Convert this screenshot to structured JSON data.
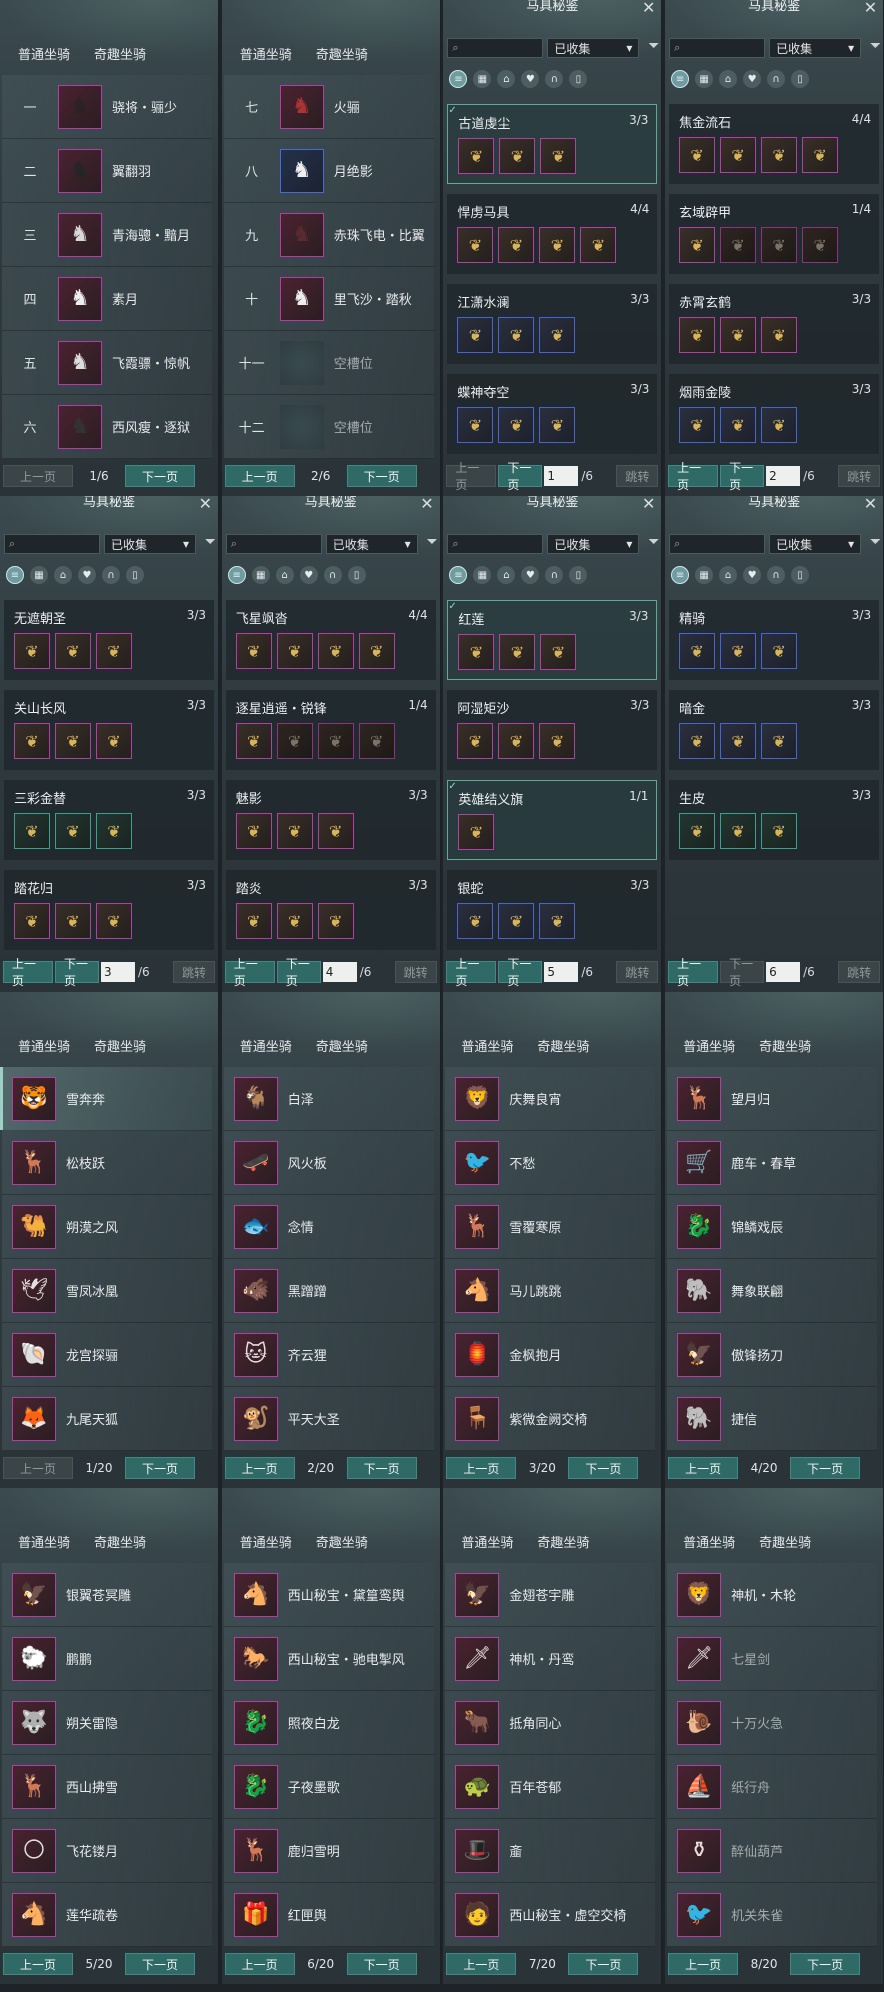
{
  "common": {
    "tab_normal": "普通坐骑",
    "tab_fun": "奇趣坐骑",
    "prev": "上一页",
    "next": "下一页",
    "jump": "跳转",
    "slash": "/",
    "tack_title": "马具秘鉴",
    "filter_value": "已收集"
  },
  "mount_pages": [
    {
      "page": "1/6",
      "prev_off": true,
      "rows": [
        {
          "n": "一",
          "name": "骁将・骊少",
          "c": "#2a2224",
          "g": "♞"
        },
        {
          "n": "二",
          "name": "翼翻羽",
          "c": "#222628",
          "g": "♞"
        },
        {
          "n": "三",
          "name": "青海骢・黯月",
          "c": "#d8d8d8",
          "g": "♞"
        },
        {
          "n": "四",
          "name": "素月",
          "c": "#eee",
          "g": "♞"
        },
        {
          "n": "五",
          "name": "飞霞骠・惊帆",
          "c": "#ddd",
          "g": "♞"
        },
        {
          "n": "六",
          "name": "西风瘦・逐狱",
          "c": "#333",
          "g": "♞"
        }
      ]
    },
    {
      "page": "2/6",
      "rows": [
        {
          "n": "七",
          "name": "火骊",
          "c": "#a33",
          "g": "♞"
        },
        {
          "n": "八",
          "name": "月绝影",
          "c": "#eee",
          "g": "♞",
          "blue": true
        },
        {
          "n": "九",
          "name": "赤珠飞电・比翼",
          "c": "#5a2a30",
          "g": "♞"
        },
        {
          "n": "十",
          "name": "里飞沙・踏秋",
          "c": "#eee",
          "g": "♞"
        },
        {
          "n": "十一",
          "name": "空槽位",
          "empty": true
        },
        {
          "n": "十二",
          "name": "空槽位",
          "empty": true
        }
      ]
    }
  ],
  "tack_pages": [
    {
      "page": "1",
      "total": "/6",
      "prev_off": true,
      "sets": [
        {
          "name": "古道虔尘",
          "score": "3/3",
          "on": true,
          "items": [
            "❦",
            "❦",
            "❦"
          ]
        },
        {
          "name": "悍虏马具",
          "score": "4/4",
          "items": [
            "❦",
            "❦",
            "❦",
            "❦"
          ]
        },
        {
          "name": "江潇水澜",
          "score": "3/3",
          "items": [
            "❦",
            "❦",
            "❦"
          ],
          "cls": "b"
        },
        {
          "name": "蝶神夺空",
          "score": "3/3",
          "items": [
            "❦",
            "❦",
            "❦"
          ],
          "cls": "b"
        }
      ]
    },
    {
      "page": "2",
      "total": "/6",
      "sets": [
        {
          "name": "焦金流石",
          "score": "4/4",
          "items": [
            "❦",
            "❦",
            "❦",
            "❦"
          ]
        },
        {
          "name": "玄域辟甲",
          "score": "1/4",
          "items": [
            "❦",
            "❦",
            "❦",
            "❦"
          ],
          "dim": true
        },
        {
          "name": "赤霄玄鹤",
          "score": "3/3",
          "items": [
            "❦",
            "❦",
            "❦"
          ]
        },
        {
          "name": "烟雨金陵",
          "score": "3/3",
          "items": [
            "❦",
            "❦",
            "❦"
          ],
          "cls": "b"
        }
      ]
    },
    {
      "page": "3",
      "total": "/6",
      "sets": [
        {
          "name": "无遮朝圣",
          "score": "3/3",
          "items": [
            "❦",
            "❦",
            "❦"
          ]
        },
        {
          "name": "关山长风",
          "score": "3/3",
          "items": [
            "❦",
            "❦",
            "❦"
          ]
        },
        {
          "name": "三彩金替",
          "score": "3/3",
          "items": [
            "❦",
            "❦",
            "❦"
          ],
          "cls": "g"
        },
        {
          "name": "踏花归",
          "score": "3/3",
          "items": [
            "❦",
            "❦",
            "❦"
          ]
        }
      ]
    },
    {
      "page": "4",
      "total": "/6",
      "sets": [
        {
          "name": "飞星飒沓",
          "score": "4/4",
          "items": [
            "❦",
            "❦",
            "❦",
            "❦"
          ]
        },
        {
          "name": "逐星逍遥・锐锋",
          "score": "1/4",
          "items": [
            "❦",
            "❦",
            "❦",
            "❦"
          ],
          "dim": true
        },
        {
          "name": "魅影",
          "score": "3/3",
          "items": [
            "❦",
            "❦",
            "❦"
          ]
        },
        {
          "name": "踏炎",
          "score": "3/3",
          "items": [
            "❦",
            "❦",
            "❦"
          ]
        }
      ]
    },
    {
      "page": "5",
      "total": "/6",
      "sets": [
        {
          "name": "红莲",
          "score": "3/3",
          "on": true,
          "items": [
            "❦",
            "❦",
            "❦"
          ]
        },
        {
          "name": "阿湿矩沙",
          "score": "3/3",
          "items": [
            "❦",
            "❦",
            "❦"
          ]
        },
        {
          "name": "英雄结义旗",
          "score": "1/1",
          "on": true,
          "items": [
            "❦"
          ]
        },
        {
          "name": "银蛇",
          "score": "3/3",
          "items": [
            "❦",
            "❦",
            "❦"
          ],
          "cls": "b"
        }
      ]
    },
    {
      "page": "6",
      "total": "/6",
      "next_off": true,
      "sets": [
        {
          "name": "精骑",
          "score": "3/3",
          "items": [
            "❦",
            "❦",
            "❦"
          ],
          "cls": "b"
        },
        {
          "name": "暗金",
          "score": "3/3",
          "items": [
            "❦",
            "❦",
            "❦"
          ],
          "cls": "b"
        },
        {
          "name": "生皮",
          "score": "3/3",
          "items": [
            "❦",
            "❦",
            "❦"
          ],
          "cls": "g"
        }
      ]
    }
  ],
  "fun_pages": [
    {
      "page": "1/20",
      "prev_off": true,
      "rows": [
        {
          "name": "雪奔奔",
          "g": "🐯",
          "sel": true
        },
        {
          "name": "松枝跃",
          "g": "🦌"
        },
        {
          "name": "朔漠之风",
          "g": "🐫"
        },
        {
          "name": "雪凤冰凰",
          "g": "🕊"
        },
        {
          "name": "龙宫探骊",
          "g": "🐚"
        },
        {
          "name": "九尾天狐",
          "g": "🦊"
        }
      ]
    },
    {
      "page": "2/20",
      "rows": [
        {
          "name": "白泽",
          "g": "🐐"
        },
        {
          "name": "风火板",
          "g": "🛹"
        },
        {
          "name": "念情",
          "g": "🐟"
        },
        {
          "name": "黑蹭蹭",
          "g": "🐗"
        },
        {
          "name": "齐云狸",
          "g": "🐱"
        },
        {
          "name": "平天大圣",
          "g": "🐒"
        }
      ]
    },
    {
      "page": "3/20",
      "rows": [
        {
          "name": "庆舞良宵",
          "g": "🦁"
        },
        {
          "name": "不愁",
          "g": "🐦"
        },
        {
          "name": "雪覆寒原",
          "g": "🦌"
        },
        {
          "name": "马儿跳跳",
          "g": "🐴"
        },
        {
          "name": "金枫抱月",
          "g": "🏮"
        },
        {
          "name": "紫微金阙交椅",
          "g": "🪑"
        }
      ]
    },
    {
      "page": "4/20",
      "rows": [
        {
          "name": "望月归",
          "g": "🦌"
        },
        {
          "name": "鹿车・春草",
          "g": "🛒"
        },
        {
          "name": "锦鳞戏辰",
          "g": "🐉"
        },
        {
          "name": "舞象联翩",
          "g": "🐘"
        },
        {
          "name": "傲锋扬刀",
          "g": "🦅"
        },
        {
          "name": "捷信",
          "g": "🐘"
        }
      ]
    },
    {
      "page": "5/20",
      "rows": [
        {
          "name": "银翼苍冥雕",
          "g": "🦅"
        },
        {
          "name": "鹏鹏",
          "g": "🐑"
        },
        {
          "name": "朔关雷隐",
          "g": "🐺"
        },
        {
          "name": "西山拂雪",
          "g": "🦌"
        },
        {
          "name": "飞花镂月",
          "g": "🌕"
        },
        {
          "name": "莲华疏卷",
          "g": "🐴"
        }
      ]
    },
    {
      "page": "6/20",
      "rows": [
        {
          "name": "西山秘宝・黛篁鸾舆",
          "g": "🐴"
        },
        {
          "name": "西山秘宝・驰电掣风",
          "g": "🐎"
        },
        {
          "name": "照夜白龙",
          "g": "🐉"
        },
        {
          "name": "子夜墨歌",
          "g": "🐉"
        },
        {
          "name": "鹿归雪明",
          "g": "🦌"
        },
        {
          "name": "红匣舆",
          "g": "🎁"
        }
      ]
    },
    {
      "page": "7/20",
      "rows": [
        {
          "name": "金翅苍宇雕",
          "g": "🦅"
        },
        {
          "name": "神机・丹鸾",
          "g": "🗡"
        },
        {
          "name": "抵角同心",
          "g": "🐂"
        },
        {
          "name": "百年苍郁",
          "g": "🐢"
        },
        {
          "name": "齑",
          "g": "🎩"
        },
        {
          "name": "西山秘宝・虚空交椅",
          "g": "🧑"
        }
      ]
    },
    {
      "page": "8/20",
      "rows": [
        {
          "name": "神机・木轮",
          "g": "🦁"
        },
        {
          "name": "七星剑",
          "g": "🗡",
          "dim": true
        },
        {
          "name": "十万火急",
          "g": "🐌",
          "dim": true
        },
        {
          "name": "纸行舟",
          "g": "⛵",
          "dim": true
        },
        {
          "name": "醉仙葫芦",
          "g": "⚱",
          "dim": true
        },
        {
          "name": "机关朱雀",
          "g": "🐦",
          "dim": true
        }
      ]
    }
  ]
}
